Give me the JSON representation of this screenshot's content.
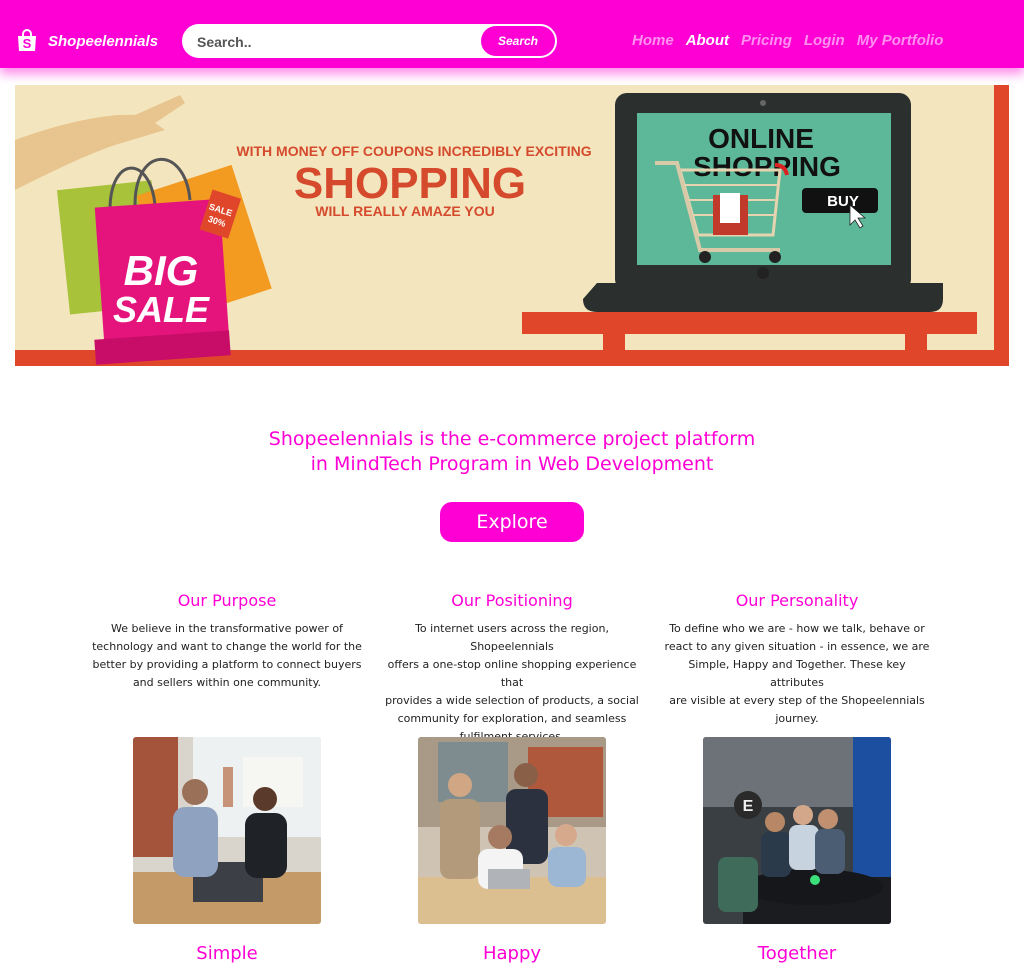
{
  "header": {
    "brand": "Shopeelennials",
    "brand_icon": "shopping-bag-icon",
    "search": {
      "placeholder": "Search..",
      "value": "",
      "button_label": "Search"
    },
    "nav": [
      {
        "label": "Home",
        "active": false
      },
      {
        "label": "About",
        "active": true
      },
      {
        "label": "Pricing",
        "active": false
      },
      {
        "label": "Login",
        "active": false
      },
      {
        "label": "My Portfolio",
        "active": false
      }
    ]
  },
  "banner": {
    "headline_top": "WITH MONEY OFF COUPONS INCREDIBLY EXCITING",
    "headline_main": "SHOPPING",
    "headline_bottom": "WILL REALLY AMAZE YOU",
    "bag_text_1": "BIG",
    "bag_text_2": "SALE",
    "tag_text_1": "SALE",
    "tag_text_2": "30%",
    "screen_text_1": "ONLINE",
    "screen_text_2": "SHOPPING",
    "buy_label": "BUY"
  },
  "intro": {
    "line1": "Shopeelennials is the e-commerce project platform",
    "line2": "in MindTech Program in Web Development",
    "explore_label": "Explore"
  },
  "features": [
    {
      "title": "Our Purpose",
      "lines": [
        "We believe in the transformative power of",
        "technology and want to change the world for the",
        "better by providing a platform to connect buyers",
        "and sellers within one community."
      ]
    },
    {
      "title": "Our Positioning",
      "lines": [
        "To internet users across the region, Shopeelennials",
        "offers a one-stop online shopping experience that",
        "provides a wide selection of products, a social",
        "community for exploration, and seamless",
        "fulfilment services."
      ]
    },
    {
      "title": "Our Personality",
      "lines": [
        "To define who we are - how we talk, behave or",
        "react to any given situation - in essence, we are",
        "Simple, Happy and Together. These key attributes",
        "are visible at every step of the Shopeelennials",
        "journey."
      ]
    }
  ],
  "values": [
    {
      "label": "Simple"
    },
    {
      "label": "Happy"
    },
    {
      "label": "Together"
    }
  ],
  "colors": {
    "brand": "#ff00d4",
    "banner_bg": "#f3e6bf",
    "banner_accent": "#e0472a"
  }
}
